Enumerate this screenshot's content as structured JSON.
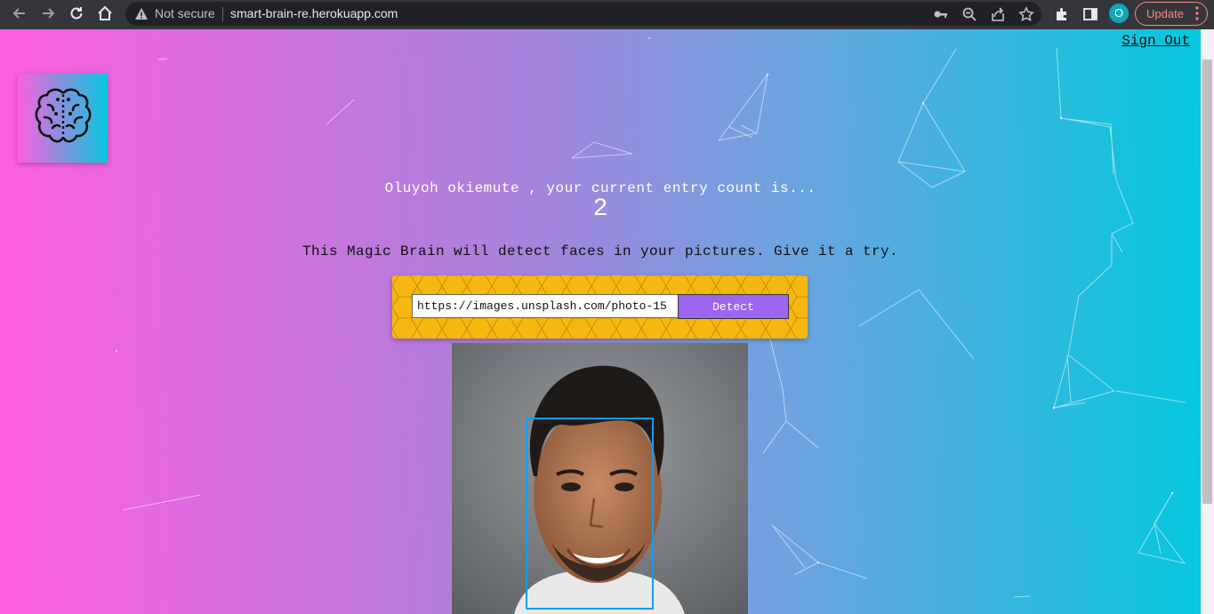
{
  "browser": {
    "security_label": "Not secure",
    "url": "smart-brain-re.herokuapp.com",
    "profile_initial": "O",
    "update_label": "Update"
  },
  "nav": {
    "signout_label": "Sign Out"
  },
  "main": {
    "greeting": "Oluyoh okiemute , your current entry count is...",
    "entry_count": "2",
    "tagline": "This Magic Brain will detect faces in your pictures. Give it a try.",
    "image_url_value": "https://images.unsplash.com/photo-15",
    "detect_label": "Detect"
  },
  "icons": {
    "logo": "brain-icon",
    "warning": "warning-triangle-icon"
  },
  "colors": {
    "gradient_start": "#ff5edf",
    "gradient_end": "#04c8de",
    "form_bg": "#f7b711",
    "detect_button": "#9d65f0",
    "face_box": "#149df2"
  }
}
